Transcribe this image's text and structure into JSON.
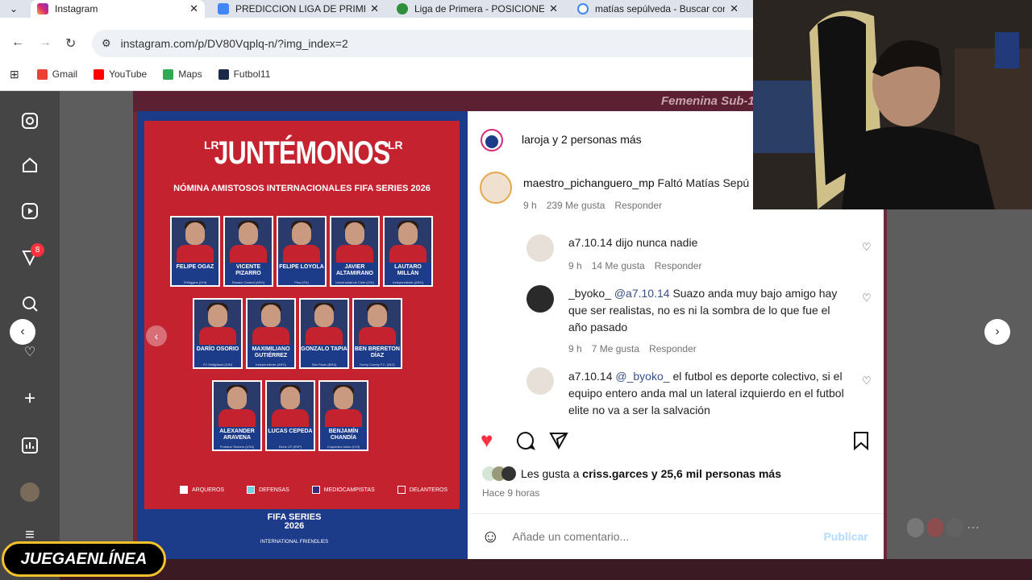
{
  "tabs": [
    {
      "title": "Instagram",
      "icon": "instagram-icon",
      "active": true
    },
    {
      "title": "PREDICCION LIGA DE PRIMERA",
      "icon": "sheets-icon",
      "active": false
    },
    {
      "title": "Liga de Primera - POSICIONES,",
      "icon": "soccer-ball-icon",
      "active": false
    },
    {
      "title": "matías sepúlveda - Buscar con",
      "icon": "google-icon",
      "active": false
    }
  ],
  "address": {
    "url": "instagram.com/p/DV80Vqplq-n/?img_index=2"
  },
  "bookmarks": [
    {
      "label": "Gmail",
      "icon": "gmail-icon",
      "color": "#ea4335"
    },
    {
      "label": "YouTube",
      "icon": "youtube-icon",
      "color": "#ff0000"
    },
    {
      "label": "Maps",
      "icon": "maps-icon",
      "color": "#34a853"
    },
    {
      "label": "Futbol11",
      "icon": "futbol11-icon",
      "color": "#1a2a4a"
    }
  ],
  "nav": {
    "notification_count": "8"
  },
  "background": {
    "banner_text": "Femenina Sub-17"
  },
  "poster": {
    "title": "JUNTÉMONOS",
    "lr_mark": "LR",
    "subtitle": "NÓMINA AMISTOSOS INTERNACIONALES FIFA SERIES 2026",
    "players_row1": [
      {
        "name": "FELIPE OGAZ",
        "club": "D'Wiggins (CHI)"
      },
      {
        "name": "VICENTE PIZARRO",
        "club": "Rosario Central (ARG)"
      },
      {
        "name": "FELIPE LOYOLA",
        "club": "Pisa (ITA)"
      },
      {
        "name": "JAVIER ALTAMIRANO",
        "club": "Universidad de Chile (CHI)"
      },
      {
        "name": "LAUTARO MILLÁN",
        "club": "Independiente (ARG)"
      }
    ],
    "players_row2": [
      {
        "name": "DARÍO OSORIO",
        "club": "FC Midtjylland (DIN)"
      },
      {
        "name": "MAXIMILIANO GUTIÉRREZ",
        "club": "Independiente (ARG)"
      },
      {
        "name": "GONZALO TAPIA",
        "club": "São Paulo (BRA)"
      },
      {
        "name": "BEN BRERETON DÍAZ",
        "club": "Derby County F.C. (ING)"
      }
    ],
    "players_row3": [
      {
        "name": "ALEXANDER ARAVENA",
        "club": "Portland Timbers (USA)"
      },
      {
        "name": "LUCAS CEPEDA",
        "club": "Elche CF (ESP)"
      },
      {
        "name": "BENJAMÍN CHANDÍA",
        "club": "Coquimbo Unido (CHI)"
      }
    ],
    "legend": [
      {
        "label": "ARQUEROS",
        "color": "#ffffff"
      },
      {
        "label": "DEFENSAS",
        "color": "#6fd3e0"
      },
      {
        "label": "MEDIOCAMPISTAS",
        "color": "#3a2a7a"
      },
      {
        "label": "DELANTEROS",
        "color": "#c4222f"
      }
    ],
    "footer_title": "FIFA SERIES",
    "footer_year": "2026",
    "footer_sub": "INTERNATIONAL FRIENDLIES"
  },
  "post": {
    "owner": "laroja",
    "owner_suffix": "y 2 personas más",
    "comments": [
      {
        "user": "maestro_pichanguero_mp",
        "text": "Faltó Matías Sepú",
        "time": "9 h",
        "likes": "239 Me gusta",
        "reply": "Responder"
      },
      {
        "user": "a7.10.14",
        "text": "dijo nunca nadie",
        "time": "9 h",
        "likes": "14 Me gusta",
        "reply": "Responder"
      },
      {
        "user": "_byoko_",
        "mention": "@a7.10.14",
        "text": "Suazo anda muy bajo amigo hay que ser realistas, no es ni la sombra de lo que fue el año pasado",
        "time": "9 h",
        "likes": "7 Me gusta",
        "reply": "Responder"
      },
      {
        "user": "a7.10.14",
        "mention": "@_byoko_",
        "text": "el futbol es deporte colectivo, si el equipo entero anda mal un lateral izquierdo en el futbol elite no va a ser la salvación"
      }
    ],
    "likes_prefix": "Les gusta a",
    "likes_user": "criss.garces",
    "likes_suffix": "y 25,6 mil personas más",
    "posted": "Hace 9 horas",
    "comment_placeholder": "Añade un comentario...",
    "publish": "Publicar"
  },
  "overlay": {
    "brand": "JUEGAENLÍNEA"
  },
  "colors": {
    "like": "#ff3040",
    "link": "#385185",
    "publish": "#b3dbff"
  }
}
